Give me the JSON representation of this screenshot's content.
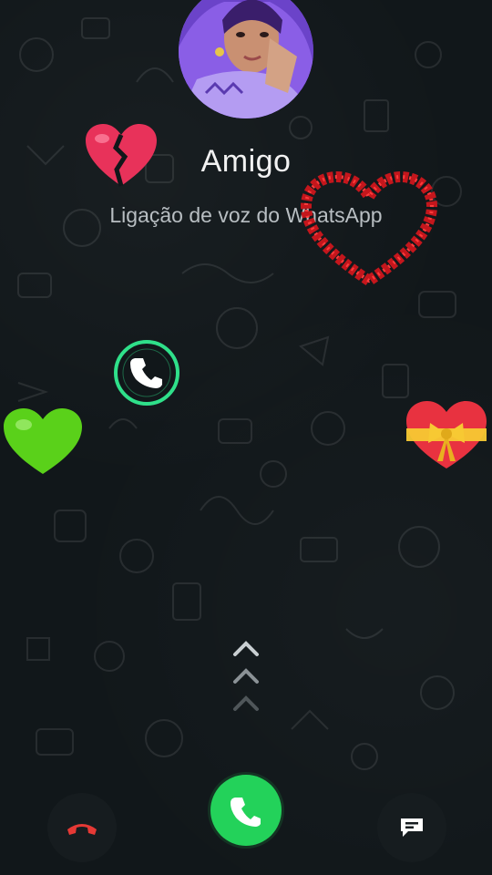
{
  "call": {
    "caller_name": "Amigo",
    "call_type": "Ligação de voz do WhatsApp"
  },
  "icons": {
    "answer_ring": "phone-icon",
    "answer": "phone-icon",
    "decline": "phone-hangup-icon",
    "message": "message-icon",
    "swipe": "chevron-up-icon"
  },
  "colors": {
    "accept_green": "#23d25a",
    "decline_red": "#e53935",
    "ring_green": "#2fe08a"
  }
}
